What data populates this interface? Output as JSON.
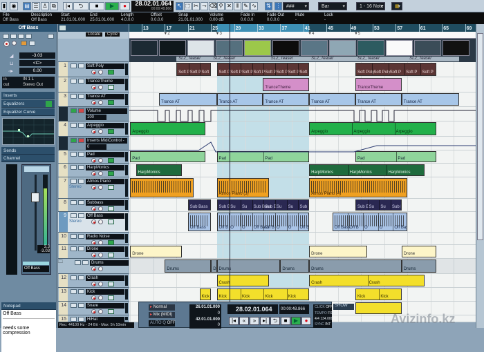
{
  "toolbar": {
    "time_main": "28.02.01.064",
    "time_sub": "00:00:48.866",
    "grid_type": "Bar",
    "quantize": "1 - 16 Note",
    "grid_mode": "###",
    "transport_icons": [
      "rewind-to-start",
      "cycle",
      "stop",
      "play",
      "record"
    ],
    "tool_icons": [
      "arrow",
      "range",
      "split",
      "glue",
      "erase",
      "zoom",
      "mute",
      "comp",
      "draw",
      "line"
    ]
  },
  "infoline": [
    {
      "label": "File",
      "value": "Off Bass"
    },
    {
      "label": "Description",
      "value": "Off Bass"
    },
    {
      "label": "Start",
      "value": "21.01.01.000"
    },
    {
      "label": "End",
      "value": "25.01.01.000"
    },
    {
      "label": "Length",
      "value": "4.0.0.0"
    },
    {
      "label": "Offset",
      "value": "0.0.0.0"
    },
    {
      "label": "Snap",
      "value": "21.01.01.000"
    },
    {
      "label": "Volume",
      "value": "0.00 dB"
    },
    {
      "label": "Fade In",
      "value": "0.0.0.0"
    },
    {
      "label": "Fade Out",
      "value": "0.0.0.0"
    },
    {
      "label": "Mute",
      "value": "-"
    },
    {
      "label": "Lock",
      "value": "-"
    }
  ],
  "inspector": {
    "title": "Off Bass",
    "volume": "-3.03",
    "pan": "<C>",
    "delay": "0.00",
    "in_label": "in",
    "in_value": "IN 1 L",
    "out_label": "out",
    "out_value": "Stereo Out",
    "sections": [
      "Inserts",
      "Equalizers",
      "Equalizer Curve",
      "Sends",
      "Channel"
    ],
    "fader_value": "-3.03",
    "fader_peak": "3.3",
    "channel_name": "Off Bass",
    "notepad_title": "Notepad",
    "notepad_heading": "Off Bass",
    "notepad_text": "needs some compression"
  },
  "tracklist_header": {
    "locate": "Locate",
    "cycle": "Cycle"
  },
  "ruler": {
    "bars": [
      "13",
      "17",
      "21",
      "25",
      "29",
      "33",
      "37",
      "41",
      "45",
      "49",
      "53",
      "57",
      "61",
      "65",
      "69"
    ],
    "cycle_start": 26,
    "cycle_end": 42,
    "cursor_bar": 28.25
  },
  "markers": [
    {
      "label": "2",
      "bar": 17
    },
    {
      "label": "3",
      "bar": 26
    },
    {
      "label": "4",
      "bar": 42
    },
    {
      "label": "5",
      "bar": 50
    }
  ],
  "video": {
    "label": "SL2_Teaser",
    "segments": [
      [
        19,
        25
      ],
      [
        25,
        35
      ],
      [
        35,
        42
      ],
      [
        42,
        50
      ],
      [
        50,
        59
      ],
      [
        59,
        68
      ]
    ]
  },
  "tracks": [
    {
      "num": "1",
      "name": "Soft Poly",
      "kind": "midi",
      "color": "#5b3534",
      "text": "#f0dada",
      "regions": [
        {
          "s": 19,
          "e": 25,
          "parts": [
            "Soft P",
            "Soft P",
            "Soft P"
          ]
        },
        {
          "s": 26,
          "e": 42,
          "parts": [
            "Soft P",
            "Soft P",
            "Soft P",
            "Soft P",
            "Soft P",
            "Soft P",
            "Soft P",
            "Soft P"
          ]
        },
        {
          "s": 50,
          "e": 64,
          "parts": [
            "Soft Poly",
            "Soft Poly",
            "Soft P",
            "Soft P",
            "Soft P"
          ]
        }
      ]
    },
    {
      "num": "2",
      "name": "TranceTheme",
      "kind": "midi",
      "color": "#d48fc9",
      "text": "#402040",
      "regions": [
        {
          "s": 34,
          "e": 42,
          "parts": [
            "TranceTheme"
          ]
        },
        {
          "s": 50,
          "e": 58,
          "parts": [
            "TranceTheme"
          ]
        }
      ]
    },
    {
      "num": "3",
      "name": "Trance AT",
      "kind": "midi",
      "color": "#a7c6e8",
      "text": "#102040",
      "regions": [
        {
          "s": 16,
          "e": 26,
          "parts": [
            "Trance AT"
          ]
        },
        {
          "s": 26,
          "e": 34,
          "parts": [
            "Trance AT"
          ]
        },
        {
          "s": 34,
          "e": 42,
          "parts": [
            "Trance AT"
          ]
        },
        {
          "s": 42,
          "e": 50,
          "parts": [
            "Trance AT"
          ]
        },
        {
          "s": 50,
          "e": 58,
          "parts": [
            "Trance AT"
          ]
        },
        {
          "s": 58,
          "e": 68,
          "parts": [
            "Trance AT"
          ]
        }
      ]
    },
    {
      "num": "",
      "name": "Volume",
      "value": "100",
      "kind": "automation",
      "regions": []
    },
    {
      "num": "4",
      "name": "Arpeggio",
      "kind": "midi",
      "color": "#22b04a",
      "text": "#08300f",
      "regions": [
        {
          "s": 11,
          "e": 24,
          "parts": [
            "Arpeggio"
          ]
        },
        {
          "s": 42,
          "e": 64,
          "parts": [
            "Arpeggio",
            "Arpeggio",
            "Arpeggio"
          ]
        }
      ]
    },
    {
      "num": "",
      "name": "Inserts MidiControl - ",
      "value": "0",
      "kind": "automation",
      "regions": []
    },
    {
      "num": "5",
      "name": "Pad",
      "kind": "midi",
      "color": "#8fd49b",
      "text": "#123",
      "regions": [
        {
          "s": 11,
          "e": 24,
          "parts": [
            "Pad"
          ]
        },
        {
          "s": 26,
          "e": 42,
          "parts": [
            "Pad",
            "Pad"
          ]
        },
        {
          "s": 50,
          "e": 64,
          "parts": [
            "Pad",
            "Pad"
          ]
        }
      ]
    },
    {
      "num": "6",
      "name": "HarpMonics",
      "kind": "midi",
      "color": "#1f6b3d",
      "text": "#e0f0e0",
      "regions": [
        {
          "s": 12,
          "e": 20,
          "parts": [
            "HarpMonics"
          ]
        },
        {
          "s": 42,
          "e": 62,
          "parts": [
            "HarpMonics",
            "HarpMonics",
            "HarpMonics"
          ]
        }
      ]
    },
    {
      "num": "7",
      "name": "Atmos Piano",
      "sub": "Stereo",
      "kind": "audio",
      "color": "#f0a020",
      "text": "#3a2000",
      "regions": [
        {
          "s": 11,
          "e": 22,
          "parts": [
            ""
          ]
        },
        {
          "s": 26,
          "e": 35,
          "parts": [
            "Atmos Piano (3)"
          ]
        },
        {
          "s": 42,
          "e": 59,
          "parts": [
            "Atmos Piano (4)"
          ]
        }
      ]
    },
    {
      "num": "8",
      "name": "Subbass",
      "kind": "midi",
      "color": "#2a2852",
      "text": "#d8d8f0",
      "regions": [
        {
          "s": 21,
          "e": 25,
          "parts": [
            "Sub Bass"
          ]
        },
        {
          "s": 26,
          "e": 42,
          "parts": [
            "Sub B",
            "Su",
            "Su",
            "Sub Bass",
            "Sub E",
            "Su",
            "Su",
            "Sub Bass"
          ]
        },
        {
          "s": 50,
          "e": 58,
          "parts": [
            "Sub E",
            "Su",
            "Su",
            "Sub Bass"
          ]
        }
      ]
    },
    {
      "num": "9",
      "name": "Off Bass",
      "sub": "Stereo",
      "kind": "audio",
      "selected": true,
      "color": "#a9c3e6",
      "text": "#102040",
      "regions": [
        {
          "s": 21,
          "e": 25,
          "parts": [
            "Off Bass"
          ]
        },
        {
          "s": 26,
          "e": 42,
          "parts": [
            "Off B",
            "O",
            "O",
            "Off Bass",
            "Off B",
            "O",
            "O",
            "Off Bass"
          ]
        },
        {
          "s": 46,
          "e": 59,
          "parts": [
            "Off Bass",
            "Off B",
            "O",
            "O",
            "Off Bass"
          ]
        }
      ]
    },
    {
      "num": "10",
      "name": "Radio Noise",
      "kind": "midi",
      "color": "#cccccc",
      "text": "#222",
      "regions": []
    },
    {
      "num": "11",
      "name": "Drone",
      "kind": "midi",
      "color": "#fdf5c8",
      "text": "#333",
      "regions": [
        {
          "s": 11,
          "e": 20,
          "parts": [
            "Drone"
          ]
        },
        {
          "s": 42,
          "e": 52,
          "parts": [
            "Drone"
          ]
        },
        {
          "s": 58,
          "e": 64,
          "parts": [
            "Drone"
          ]
        }
      ]
    },
    {
      "num": "",
      "name": "Drums",
      "kind": "folder",
      "color": "#8a9cac",
      "text": "#102030",
      "regions": [
        {
          "s": 17,
          "e": 25,
          "parts": [
            "Drums"
          ]
        },
        {
          "s": 25,
          "e": 26,
          "parts": [
            "Dr"
          ]
        },
        {
          "s": 26,
          "e": 37,
          "parts": [
            "Drums"
          ]
        },
        {
          "s": 37,
          "e": 42,
          "parts": [
            "Drums"
          ]
        },
        {
          "s": 42,
          "e": 58,
          "parts": [
            "Drums"
          ]
        },
        {
          "s": 58,
          "e": 64,
          "parts": [
            "Drums"
          ]
        }
      ]
    },
    {
      "num": "12",
      "name": "Crash",
      "kind": "midi",
      "color": "#f3df2b",
      "text": "#332b00",
      "regions": [
        {
          "s": 26,
          "e": 35,
          "parts": [
            "Crash"
          ]
        },
        {
          "s": 42,
          "e": 62,
          "parts": [
            "Crash",
            "Crash"
          ]
        }
      ]
    },
    {
      "num": "13",
      "name": "Kick",
      "kind": "midi",
      "color": "#f3df2b",
      "text": "#332b00",
      "regions": [
        {
          "s": 23,
          "e": 25,
          "parts": [
            "Kick"
          ]
        },
        {
          "s": 26,
          "e": 42,
          "parts": [
            "Kick",
            "Kick",
            "Kick",
            "Kick"
          ]
        },
        {
          "s": 50,
          "e": 58,
          "parts": [
            "Kick",
            "Kick"
          ]
        }
      ]
    },
    {
      "num": "14",
      "name": "Snare",
      "kind": "midi",
      "color": "#f3df2b",
      "text": "#332b00",
      "regions": [
        {
          "s": 26,
          "e": 42,
          "parts": [
            ""
          ]
        },
        {
          "s": 50,
          "e": 58,
          "parts": [
            ""
          ]
        }
      ]
    },
    {
      "num": "15",
      "name": "HiHat",
      "kind": "midi",
      "color": "#f3df2b",
      "text": "#332b00",
      "regions": []
    }
  ],
  "statusbar": "Rec: 44100 Hz - 24 Bit - Max: 5h 10min",
  "transport": {
    "mode": "Normal",
    "mix": "Mix (MIDI)",
    "auto_label": "AUTO Q",
    "auto_value": "OFF",
    "left_locator": "26.01.01.000",
    "right_locator": "42.01.01.000",
    "left_offset": "0",
    "right_offset": "0",
    "position": "28.02.01.064",
    "time": "00:00:48.866",
    "click_label": "CLICK",
    "click_value": "OFF",
    "tempo_label": "TEMPO",
    "tempo_value": "FIXED",
    "signature": "4/4",
    "tempo": "134.000",
    "sync_label": "SYNC",
    "sync_value": "INT",
    "show_label": "SHOW"
  },
  "watermark": "Avizinfo.kz"
}
